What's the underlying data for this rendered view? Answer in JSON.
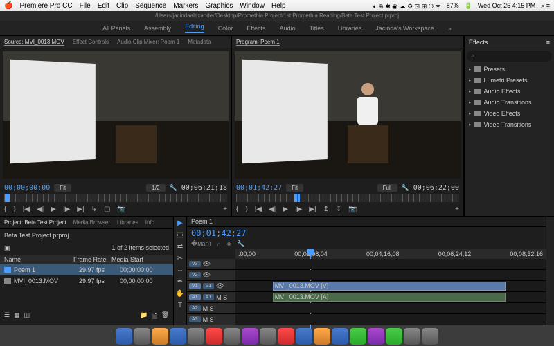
{
  "menubar": {
    "app": "Premiere Pro CC",
    "items": [
      "File",
      "Edit",
      "Clip",
      "Sequence",
      "Markers",
      "Graphics",
      "Window",
      "Help"
    ],
    "battery": "87%",
    "datetime": "Wed Oct 25  4:15 PM"
  },
  "path": "/Users/jacindaalexander/Desktop/Promethia Project/1st Promethia Reading/Beta Test Project.prproj",
  "workspaces": [
    "All Panels",
    "Assembly",
    "Editing",
    "Color",
    "Effects",
    "Audio",
    "Titles",
    "Libraries",
    "Jacinda's Workspace"
  ],
  "workspace_active": "Editing",
  "source": {
    "tabs": [
      "Source: MVI_0013.MOV",
      "Effect Controls",
      "Audio Clip Mixer: Poem 1",
      "Metadata"
    ],
    "tc_in": "00;00;00;00",
    "fit": "Fit",
    "fraction": "1/2",
    "tc_out": "00;06;21;18"
  },
  "program": {
    "tab": "Program: Poem 1",
    "tc_in": "00;01;42;27",
    "fit": "Fit",
    "full": "Full",
    "tc_out": "00;06;22;00"
  },
  "effects": {
    "title": "Effects",
    "search_placeholder": "⌕",
    "items": [
      "Presets",
      "Lumetri Presets",
      "Audio Effects",
      "Audio Transitions",
      "Video Effects",
      "Video Transitions"
    ]
  },
  "project": {
    "tabs": [
      "Project: Beta Test Project",
      "Media Browser",
      "Libraries",
      "Info"
    ],
    "file": "Beta Test Project.prproj",
    "selection": "1 of 2 items selected",
    "columns": [
      "Name",
      "Frame Rate",
      "Media Start"
    ],
    "rows": [
      {
        "name": "Poem 1",
        "rate": "29.97 fps",
        "start": "00;00;00;00"
      },
      {
        "name": "MVI_0013.MOV",
        "rate": "29.97 fps",
        "start": "00;00;00;00"
      }
    ]
  },
  "timeline": {
    "title": "Poem 1",
    "tc": "00;01;42;27",
    "marks": [
      ":00;00",
      "00;02;08;04",
      "00;04;16;08",
      "00;06;24;12",
      "00;08;32;16"
    ],
    "tracks": {
      "v3": "V3",
      "v2": "V2",
      "v1": "V1",
      "a1": "A1",
      "a2": "A2",
      "a3": "A3"
    },
    "clip_v": "MVI_0013.MOV [V]",
    "clip_a": "MVI_0013.MOV [A]"
  }
}
